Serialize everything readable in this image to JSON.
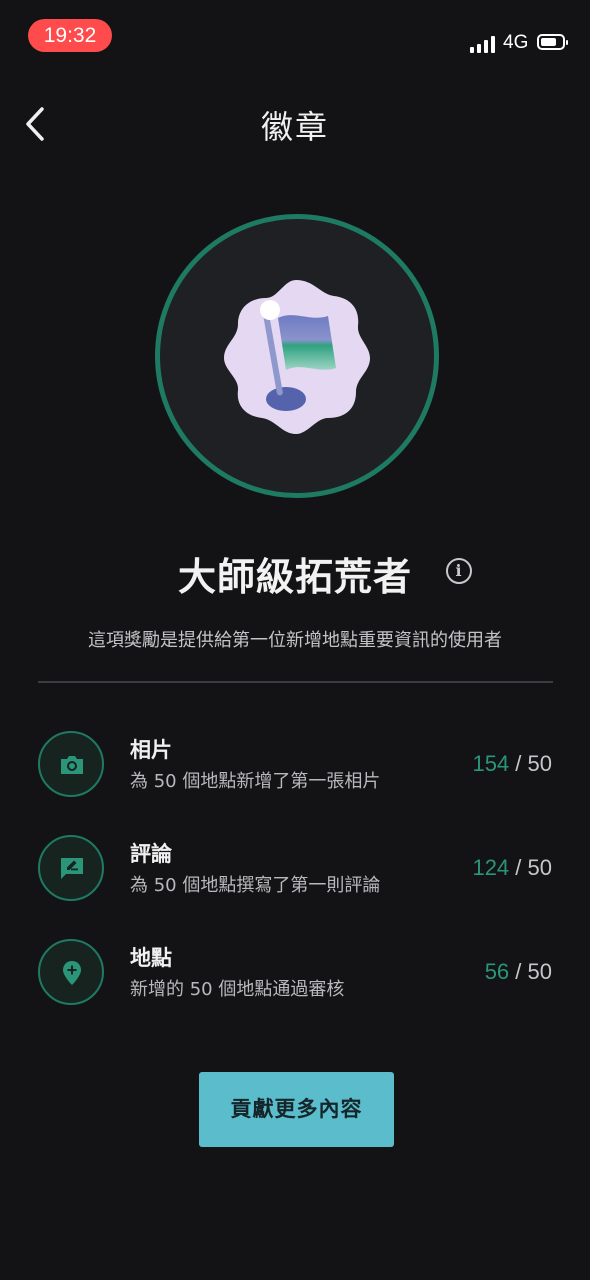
{
  "status_bar": {
    "time": "19:32",
    "network": "4G",
    "colors": {
      "time_pill": "#ff4b4b"
    }
  },
  "header": {
    "back_icon": "chevron-left-icon",
    "title": "徽章"
  },
  "badge": {
    "icon": "flag-badge-icon",
    "name": "大師級拓荒者",
    "info_icon_glyph": "i",
    "description": "這項獎勵是提供給第一位新增地點重要資訊的使用者",
    "colors": {
      "ring": "#1e7a62"
    }
  },
  "requirements": [
    {
      "icon": "camera-icon",
      "title": "相片",
      "subtitle": "為 50 個地點新增了第一張相片",
      "current": "154",
      "separator": " / ",
      "target": "50"
    },
    {
      "icon": "review-edit-icon",
      "title": "評論",
      "subtitle": "為 50 個地點撰寫了第一則評論",
      "current": "124",
      "separator": " / ",
      "target": "50"
    },
    {
      "icon": "add-location-icon",
      "title": "地點",
      "subtitle": "新增的 50 個地點通過審核",
      "current": "56",
      "separator": " / ",
      "target": "50"
    }
  ],
  "cta": {
    "label": "貢獻更多內容",
    "colors": {
      "background": "#5bbccc"
    }
  },
  "colors": {
    "background": "#131315",
    "accent_green": "#2a9578"
  }
}
